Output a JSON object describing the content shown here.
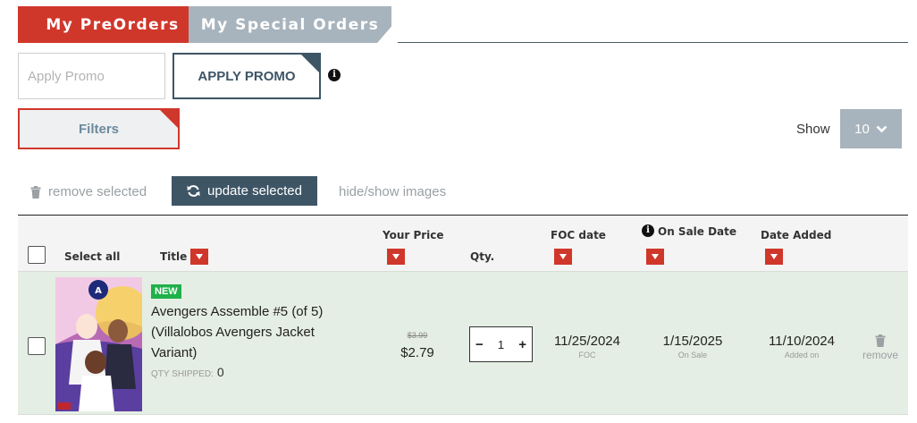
{
  "tabs": [
    {
      "label": "My PreOrders",
      "active": true
    },
    {
      "label": "My Special Orders",
      "active": false
    }
  ],
  "promo": {
    "placeholder": "Apply Promo",
    "value": "",
    "button_label": "APPLY PROMO",
    "info_icon": "info-icon"
  },
  "filters": {
    "label": "Filters"
  },
  "show": {
    "label": "Show",
    "value": "10"
  },
  "actions": {
    "remove_selected": "remove selected",
    "update_selected": "update selected",
    "hide_show_images": "hide/show images"
  },
  "table": {
    "select_all": "Select all",
    "columns": {
      "title": "Title",
      "your_price": "Your Price",
      "qty": "Qty.",
      "foc_date": "FOC date",
      "on_sale_date": "On Sale Date",
      "date_added": "Date Added"
    },
    "rows": [
      {
        "badge": "NEW",
        "title": "Avengers Assemble #5 (of 5) (Villalobos Avengers Jacket Variant)",
        "qty_shipped_label": "QTY SHIPPED:",
        "qty_shipped": "0",
        "old_price": "$3.99",
        "price": "$2.79",
        "qty": "1",
        "foc_date": "11/25/2024",
        "foc_sub": "FOC",
        "on_sale_date": "1/15/2025",
        "on_sale_sub": "On Sale",
        "date_added": "11/10/2024",
        "date_added_sub": "Added on",
        "remove_label": "remove"
      }
    ]
  },
  "colors": {
    "accent_red": "#d0372b",
    "slate": "#3e5566",
    "gray_tab": "#a8b4bd",
    "row_bg": "#e5eee4",
    "new_badge": "#1fb04a"
  }
}
